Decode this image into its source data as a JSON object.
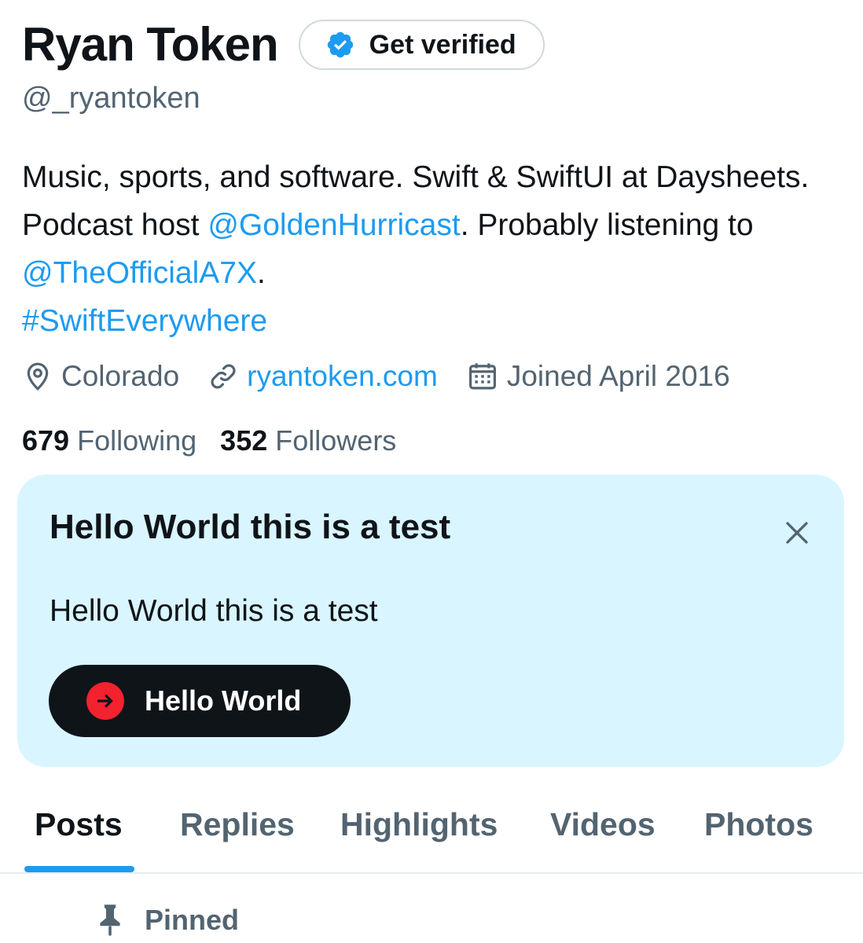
{
  "profile": {
    "display_name": "Ryan Token",
    "verify_button_label": "Get verified",
    "handle": "@_ryantoken",
    "bio": {
      "part1": "Music, sports, and software. Swift & SwiftUI at Daysheets. Podcast host ",
      "mention1": "@GoldenHurricast",
      "part2": ". Probably listening to ",
      "mention2": "@TheOfficialA7X",
      "part3": ". ",
      "hashtag": "#SwiftEverywhere"
    },
    "location": "Colorado",
    "website": "ryantoken.com",
    "joined": "Joined April 2016",
    "following_count": "679",
    "following_label": "Following",
    "followers_count": "352",
    "followers_label": "Followers"
  },
  "card": {
    "title": "Hello World this is a test",
    "body": "Hello World this is a test",
    "button_label": "Hello World"
  },
  "tabs": [
    {
      "label": "Posts",
      "active": true
    },
    {
      "label": "Replies",
      "active": false
    },
    {
      "label": "Highlights",
      "active": false
    },
    {
      "label": "Videos",
      "active": false
    },
    {
      "label": "Photos",
      "active": false
    }
  ],
  "pinned": {
    "label": "Pinned"
  },
  "icons": {
    "verified": "verified-badge-icon",
    "location": "location-pin-icon",
    "link": "link-icon",
    "calendar": "calendar-icon",
    "close": "close-icon",
    "arrow": "arrow-right-icon",
    "pin": "pin-icon"
  },
  "colors": {
    "accent": "#1d9bf0",
    "text_primary": "#0f1419",
    "text_secondary": "#536471",
    "card_background": "#d9f5ff",
    "button_dark": "#0f1419",
    "button_icon_red": "#f4212e",
    "divider": "#e6ecf0"
  }
}
